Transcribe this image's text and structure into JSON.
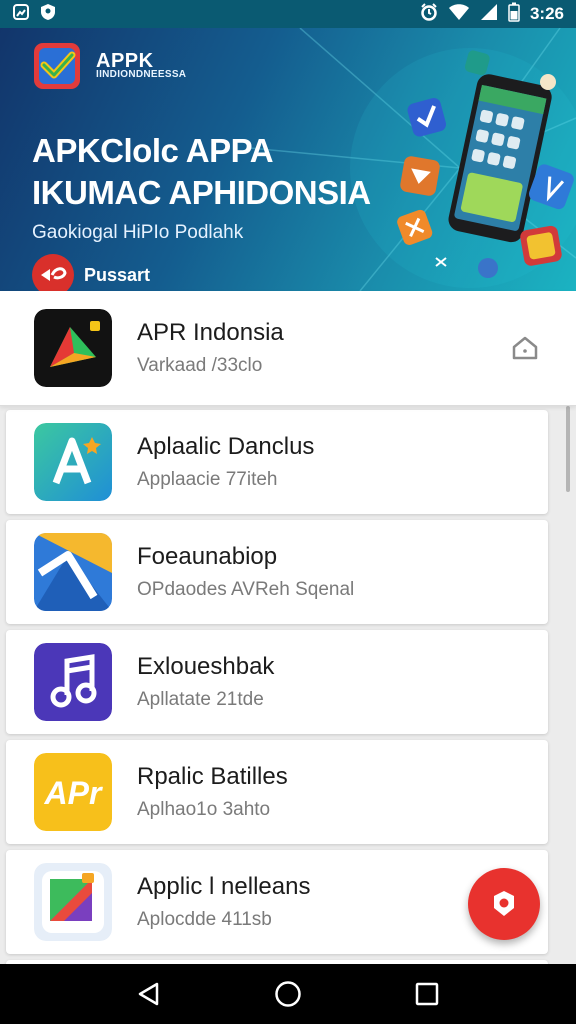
{
  "status_bar": {
    "time": "3:26",
    "icons": [
      "gallery-icon",
      "shield-icon",
      "alarm-icon",
      "wifi-icon",
      "signal-icon",
      "battery-icon"
    ]
  },
  "banner": {
    "brand_name": "APPK",
    "brand_subtitle": "IINDIONDNEESSA",
    "title_line1": "APKClolc APPA",
    "title_line2": "IKUMAC APHIDONSIA",
    "tagline": "Gaokiogal HiPIo Podlahk",
    "author": "Pussart"
  },
  "featured": {
    "title": "APR Indonsia",
    "subtitle": "Varkaad /33clo",
    "action_icon": "download-icon"
  },
  "apps": [
    {
      "title": "Aplaalic Danclus",
      "subtitle": "Applaacie 77iteh",
      "icon": "letter-a-icon"
    },
    {
      "title": "Foeaunabiop",
      "subtitle": "OPdaodes AVReh Sqenal",
      "icon": "arrow-icon"
    },
    {
      "title": "Exloueshbak",
      "subtitle": "Apllatate 21tde",
      "icon": "music-icon"
    },
    {
      "title": "Rpalic Batilles",
      "subtitle": "Aplhao1o 3ahto",
      "icon": "apr-icon"
    },
    {
      "title": "Applic l nelleans",
      "subtitle": "Aplocdde 411sb",
      "icon": "play-icon"
    }
  ],
  "colors": {
    "accent": "#e8322e",
    "banner_start": "#12356b",
    "banner_end": "#1bb3c2",
    "status_bar": "#0a5a72"
  }
}
